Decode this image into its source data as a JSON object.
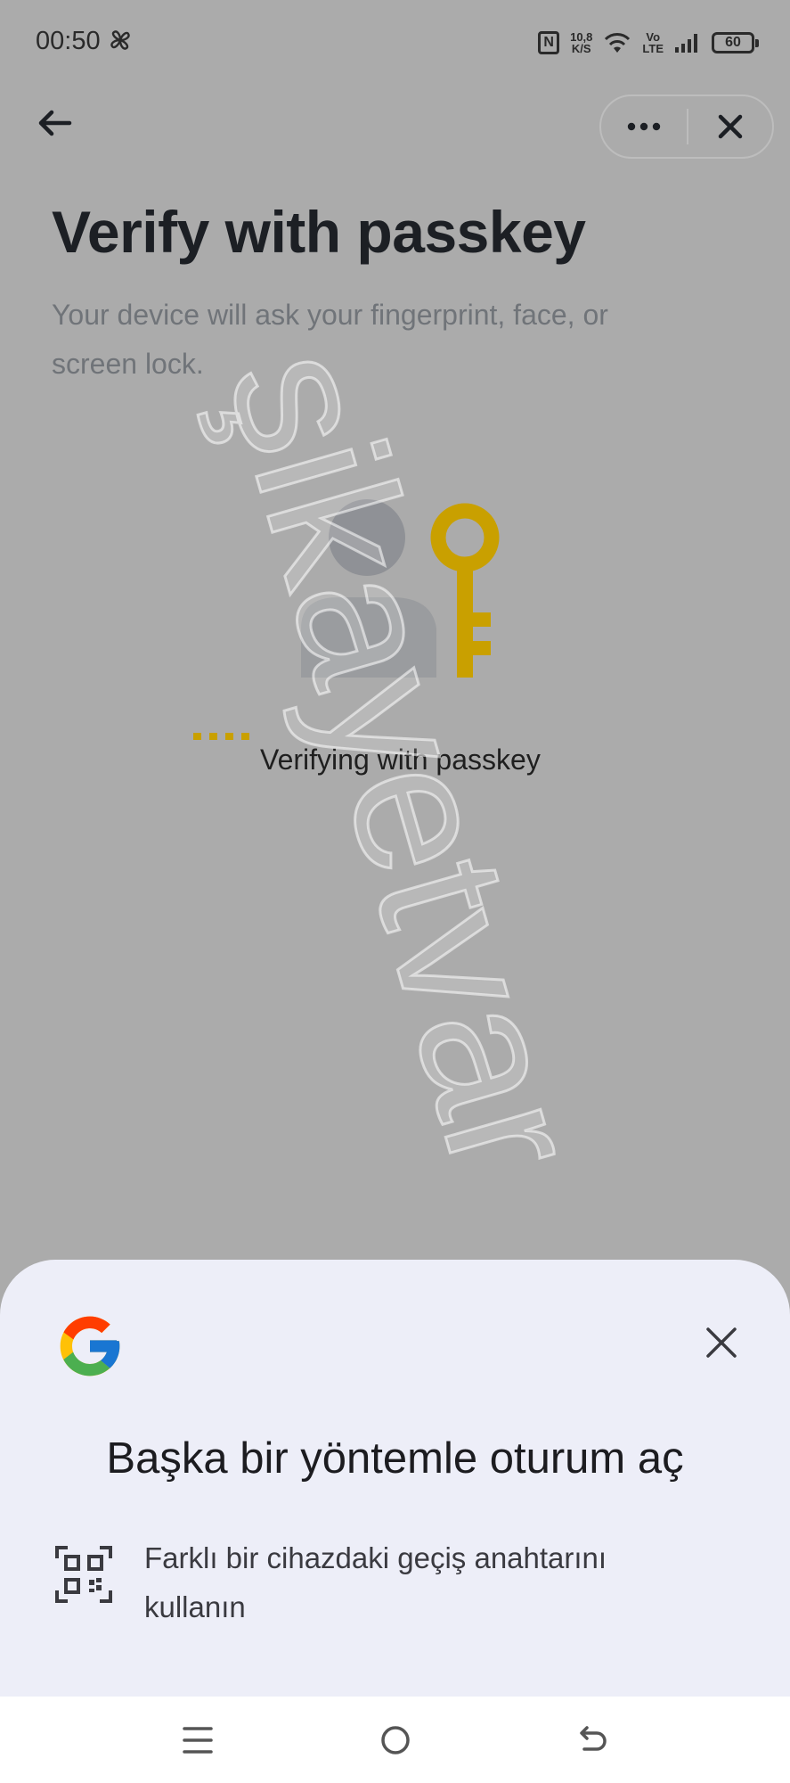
{
  "status_bar": {
    "time": "00:50",
    "network_speed_value": "10,8",
    "network_speed_unit": "K/S",
    "volte_top": "Vo",
    "volte_bottom": "LTE",
    "battery_level": "60",
    "icons": [
      "fan-icon",
      "nfc-icon",
      "wifi-icon",
      "signal-icon",
      "battery-icon"
    ]
  },
  "header": {
    "back_icon": "arrow-left-icon",
    "more_icon": "more-horizontal-icon",
    "close_icon": "close-icon"
  },
  "main": {
    "title": "Verify with passkey",
    "subtitle": "Your device will ask your fingerprint, face, or screen lock.",
    "illustration_icons": [
      "user-icon",
      "key-icon"
    ],
    "status_text": "Verifying with passkey",
    "accent_color": "#c9a000"
  },
  "watermark": {
    "text": "şikayetvar"
  },
  "bottom_sheet": {
    "brand_icon": "google-logo-icon",
    "close_icon": "close-icon",
    "title": "Başka bir yöntemle oturum aç",
    "options": [
      {
        "icon": "qr-code-icon",
        "label": "Farklı bir cihazdaki geçiş anahtarını kullanın"
      }
    ],
    "background_color": "#edeef8"
  },
  "nav_bar": {
    "icons": [
      "menu-icon",
      "home-icon",
      "back-icon"
    ]
  }
}
